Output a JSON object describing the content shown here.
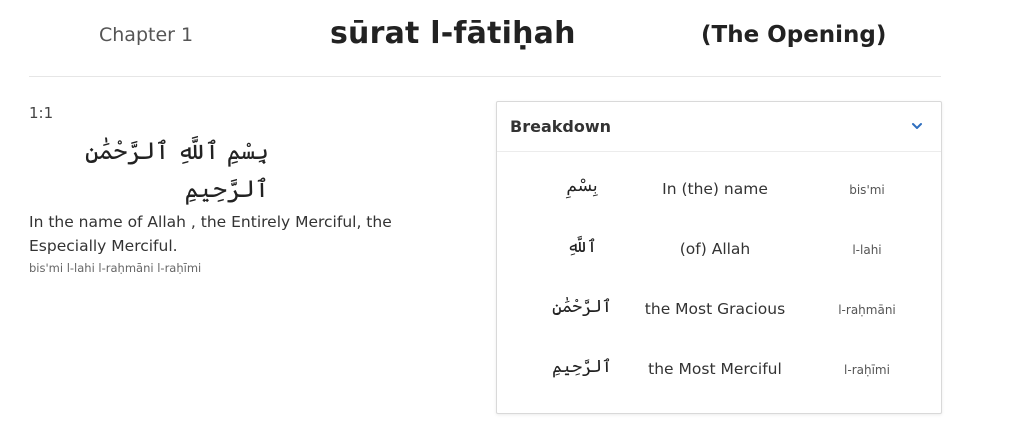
{
  "header": {
    "chapter_label": "Chapter 1",
    "surah_name": "sūrat l-fātiḥah",
    "surah_meaning": "(The Opening)"
  },
  "verse": {
    "number": "1:1",
    "arabic": "بِسْمِ ٱللَّهِ ٱلرَّحْمَٰنِ ٱلرَّحِيمِ",
    "translation": "In the name of Allah , the Entirely Merciful, the Especially Merciful.",
    "transliteration": "bis'mi l-lahi l-raḥmāni l-raḥīmi"
  },
  "breakdown": {
    "title": "Breakdown",
    "toggle_icon": "chevron-down-icon",
    "accent_color": "#2f6fbf",
    "words": [
      {
        "arabic": "بِسْمِ",
        "english": "In (the) name",
        "translit": "bis'mi"
      },
      {
        "arabic": "ٱللَّهِ",
        "english": "(of) Allah",
        "translit": "l-lahi"
      },
      {
        "arabic": "ٱلرَّحْمَٰنِ",
        "english": "the Most Gracious",
        "translit": "l-raḥmāni"
      },
      {
        "arabic": "ٱلرَّحِيمِ",
        "english": "the Most Merciful",
        "translit": "l-raḥīmi"
      }
    ]
  }
}
